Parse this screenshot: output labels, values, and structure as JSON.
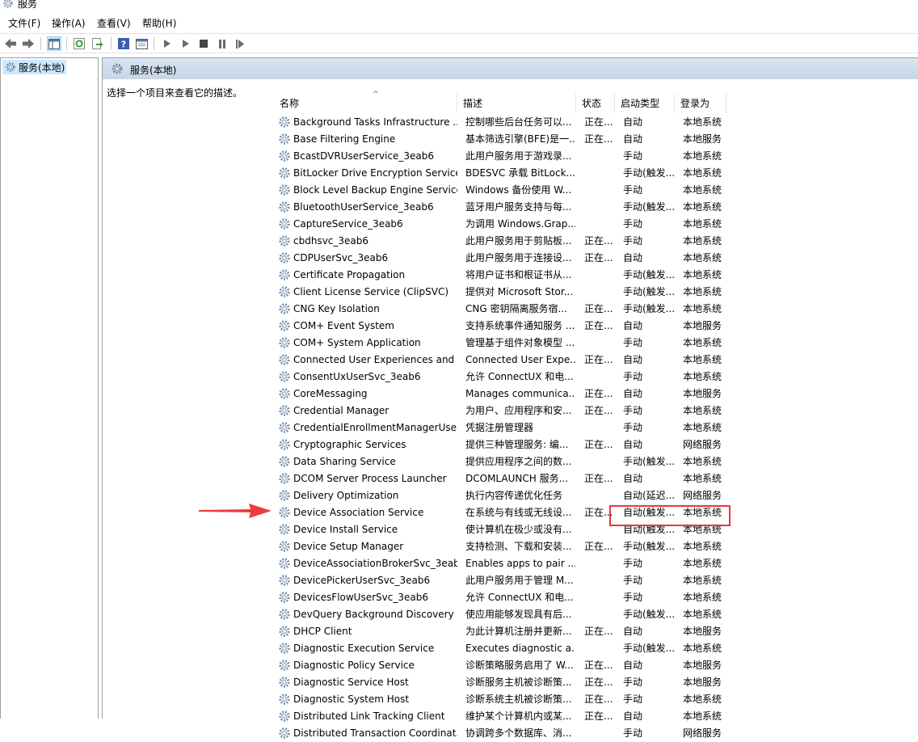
{
  "window": {
    "title": "服务"
  },
  "menu": [
    "文件(F)",
    "操作(A)",
    "查看(V)",
    "帮助(H)"
  ],
  "toolbar": {
    "icons": [
      "back-icon",
      "forward-icon",
      "console-tree-icon",
      "refresh-icon",
      "export-icon",
      "help-icon",
      "properties-icon",
      "start-icon",
      "start-alt-icon",
      "stop-icon",
      "pause-icon",
      "restart-icon"
    ]
  },
  "tree": {
    "root_label": "服务(本地)"
  },
  "pane": {
    "header_title": "服务(本地)",
    "description_hint": "选择一个项目来查看它的描述。"
  },
  "columns": {
    "name": "名称",
    "description": "描述",
    "status": "状态",
    "startup_type": "启动类型",
    "logon_as": "登录为"
  },
  "services": [
    {
      "name": "Background Tasks Infrastructure ...",
      "description": "控制哪些后台任务可以...",
      "status": "正在...",
      "startup": "自动",
      "logon": "本地系统"
    },
    {
      "name": "Base Filtering Engine",
      "description": "基本筛选引擎(BFE)是一...",
      "status": "正在...",
      "startup": "自动",
      "logon": "本地服务"
    },
    {
      "name": "BcastDVRUserService_3eab6",
      "description": "此用户服务用于游戏录...",
      "status": "",
      "startup": "手动",
      "logon": "本地系统"
    },
    {
      "name": "BitLocker Drive Encryption Service",
      "description": "BDESVC 承载 BitLock...",
      "status": "",
      "startup": "手动(触发...",
      "logon": "本地系统"
    },
    {
      "name": "Block Level Backup Engine Service",
      "description": "Windows 备份使用 W...",
      "status": "",
      "startup": "手动",
      "logon": "本地系统"
    },
    {
      "name": "BluetoothUserService_3eab6",
      "description": "蓝牙用户服务支持与每...",
      "status": "",
      "startup": "手动(触发...",
      "logon": "本地系统"
    },
    {
      "name": "CaptureService_3eab6",
      "description": "为调用 Windows.Grap...",
      "status": "",
      "startup": "手动",
      "logon": "本地系统"
    },
    {
      "name": "cbdhsvc_3eab6",
      "description": "此用户服务用于剪贴板...",
      "status": "正在...",
      "startup": "手动",
      "logon": "本地系统"
    },
    {
      "name": "CDPUserSvc_3eab6",
      "description": "此用户服务用于连接设...",
      "status": "正在...",
      "startup": "自动",
      "logon": "本地系统"
    },
    {
      "name": "Certificate Propagation",
      "description": "将用户证书和根证书从...",
      "status": "",
      "startup": "手动(触发...",
      "logon": "本地系统"
    },
    {
      "name": "Client License Service (ClipSVC)",
      "description": "提供对 Microsoft Stor...",
      "status": "",
      "startup": "手动(触发...",
      "logon": "本地系统"
    },
    {
      "name": "CNG Key Isolation",
      "description": "CNG 密钥隔离服务宿...",
      "status": "正在...",
      "startup": "手动(触发...",
      "logon": "本地系统"
    },
    {
      "name": "COM+ Event System",
      "description": "支持系统事件通知服务 ...",
      "status": "正在...",
      "startup": "自动",
      "logon": "本地服务"
    },
    {
      "name": "COM+ System Application",
      "description": "管理基于组件对象模型 ...",
      "status": "",
      "startup": "手动",
      "logon": "本地系统"
    },
    {
      "name": "Connected User Experiences and ...",
      "description": "Connected User Expe...",
      "status": "正在...",
      "startup": "自动",
      "logon": "本地系统"
    },
    {
      "name": "ConsentUxUserSvc_3eab6",
      "description": "允许 ConnectUX 和电...",
      "status": "",
      "startup": "手动",
      "logon": "本地系统"
    },
    {
      "name": "CoreMessaging",
      "description": "Manages communica...",
      "status": "正在...",
      "startup": "自动",
      "logon": "本地服务"
    },
    {
      "name": "Credential Manager",
      "description": "为用户、应用程序和安...",
      "status": "正在...",
      "startup": "手动",
      "logon": "本地系统"
    },
    {
      "name": "CredentialEnrollmentManagerUse...",
      "description": "凭据注册管理器",
      "status": "",
      "startup": "手动",
      "logon": "本地系统"
    },
    {
      "name": "Cryptographic Services",
      "description": "提供三种管理服务: 编...",
      "status": "正在...",
      "startup": "自动",
      "logon": "网络服务"
    },
    {
      "name": "Data Sharing Service",
      "description": "提供应用程序之间的数...",
      "status": "",
      "startup": "手动(触发...",
      "logon": "本地系统"
    },
    {
      "name": "DCOM Server Process Launcher",
      "description": "DCOMLAUNCH 服务...",
      "status": "正在...",
      "startup": "自动",
      "logon": "本地系统"
    },
    {
      "name": "Delivery Optimization",
      "description": "执行内容传递优化任务",
      "status": "",
      "startup": "自动(延迟...",
      "logon": "网络服务"
    },
    {
      "name": "Device Association Service",
      "description": "在系统与有线或无线设...",
      "status": "正在...",
      "startup": "自动(触发...",
      "logon": "本地系统"
    },
    {
      "name": "Device Install Service",
      "description": "使计算机在极少或没有...",
      "status": "",
      "startup": "自动(触发...",
      "logon": "本地系统"
    },
    {
      "name": "Device Setup Manager",
      "description": "支持检测、下载和安装...",
      "status": "正在...",
      "startup": "手动(触发...",
      "logon": "本地系统"
    },
    {
      "name": "DeviceAssociationBrokerSvc_3eab6",
      "description": "Enables apps to pair ...",
      "status": "",
      "startup": "手动",
      "logon": "本地系统"
    },
    {
      "name": "DevicePickerUserSvc_3eab6",
      "description": "此用户服务用于管理 M...",
      "status": "",
      "startup": "手动",
      "logon": "本地系统"
    },
    {
      "name": "DevicesFlowUserSvc_3eab6",
      "description": "允许 ConnectUX 和电...",
      "status": "",
      "startup": "手动",
      "logon": "本地系统"
    },
    {
      "name": "DevQuery Background Discovery ...",
      "description": "使应用能够发现具有后...",
      "status": "",
      "startup": "手动(触发...",
      "logon": "本地系统"
    },
    {
      "name": "DHCP Client",
      "description": "为此计算机注册并更新...",
      "status": "正在...",
      "startup": "自动",
      "logon": "本地服务"
    },
    {
      "name": "Diagnostic Execution Service",
      "description": "Executes diagnostic a...",
      "status": "",
      "startup": "手动(触发...",
      "logon": "本地系统"
    },
    {
      "name": "Diagnostic Policy Service",
      "description": "诊断策略服务启用了 W...",
      "status": "正在...",
      "startup": "自动",
      "logon": "本地服务"
    },
    {
      "name": "Diagnostic Service Host",
      "description": "诊断服务主机被诊断策...",
      "status": "正在...",
      "startup": "手动",
      "logon": "本地服务"
    },
    {
      "name": "Diagnostic System Host",
      "description": "诊断系统主机被诊断策...",
      "status": "正在...",
      "startup": "手动",
      "logon": "本地系统"
    },
    {
      "name": "Distributed Link Tracking Client",
      "description": "维护某个计算机内或某...",
      "status": "正在...",
      "startup": "自动",
      "logon": "本地系统"
    },
    {
      "name": "Distributed Transaction Coordinat...",
      "description": "协调跨多个数据库、消...",
      "status": "",
      "startup": "手动",
      "logon": "网络服务"
    }
  ]
}
